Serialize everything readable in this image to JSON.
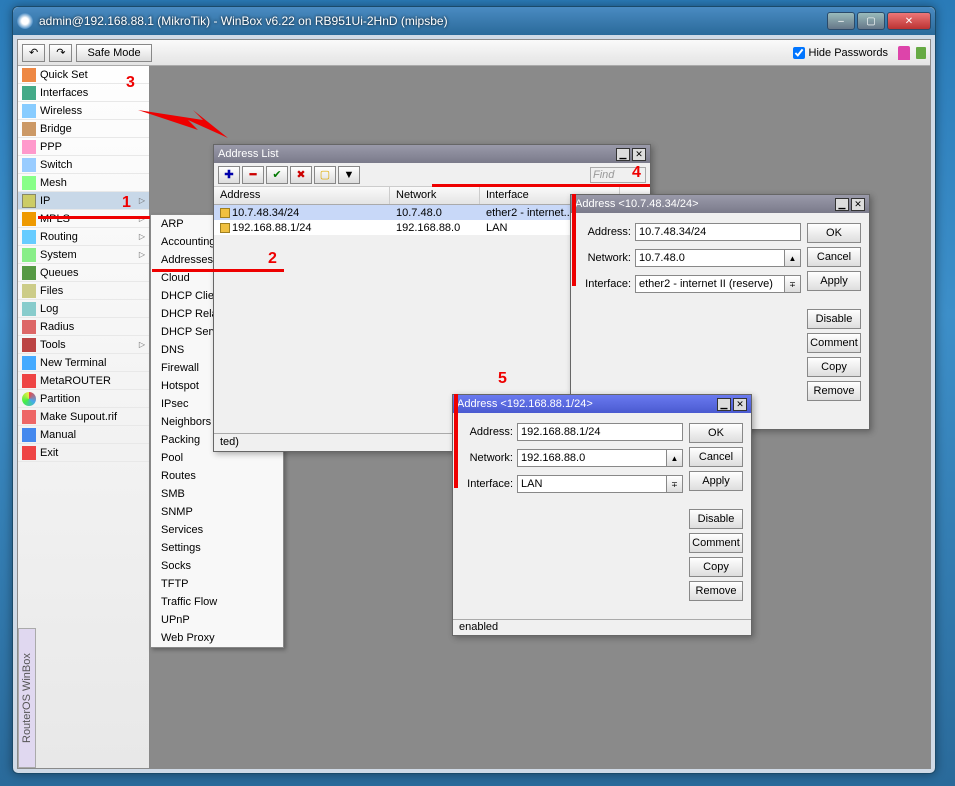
{
  "window": {
    "title": "admin@192.168.88.1 (MikroTik) - WinBox v6.22 on RB951Ui-2HnD (mipsbe)"
  },
  "toolbar": {
    "undo_glyph": "↶",
    "redo_glyph": "↷",
    "safe_mode": "Safe Mode",
    "hide_passwords": "Hide Passwords"
  },
  "sidebar": {
    "items": [
      {
        "label": "Quick Set",
        "icon": "i-quick"
      },
      {
        "label": "Interfaces",
        "icon": "i-if"
      },
      {
        "label": "Wireless",
        "icon": "i-wl"
      },
      {
        "label": "Bridge",
        "icon": "i-br"
      },
      {
        "label": "PPP",
        "icon": "i-ppp"
      },
      {
        "label": "Switch",
        "icon": "i-sw"
      },
      {
        "label": "Mesh",
        "icon": "i-mesh"
      },
      {
        "label": "IP",
        "icon": "i-ip",
        "sub": true,
        "sel": true
      },
      {
        "label": "MPLS",
        "icon": "i-mpls",
        "sub": true
      },
      {
        "label": "Routing",
        "icon": "i-rt",
        "sub": true
      },
      {
        "label": "System",
        "icon": "i-sys",
        "sub": true
      },
      {
        "label": "Queues",
        "icon": "i-q"
      },
      {
        "label": "Files",
        "icon": "i-fl"
      },
      {
        "label": "Log",
        "icon": "i-log"
      },
      {
        "label": "Radius",
        "icon": "i-rad"
      },
      {
        "label": "Tools",
        "icon": "i-tl",
        "sub": true
      },
      {
        "label": "New Terminal",
        "icon": "i-nt"
      },
      {
        "label": "MetaROUTER",
        "icon": "i-mr"
      },
      {
        "label": "Partition",
        "icon": "i-pt"
      },
      {
        "label": "Make Supout.rif",
        "icon": "i-ms"
      },
      {
        "label": "Manual",
        "icon": "i-mn"
      },
      {
        "label": "Exit",
        "icon": "i-ex"
      }
    ],
    "vertical_label": "RouterOS WinBox"
  },
  "submenu": {
    "items": [
      "ARP",
      "Accounting",
      "Addresses",
      "Cloud",
      "DHCP Client",
      "DHCP Relay",
      "DHCP Server",
      "DNS",
      "Firewall",
      "Hotspot",
      "IPsec",
      "Neighbors",
      "Packing",
      "Pool",
      "Routes",
      "SMB",
      "SNMP",
      "Services",
      "Settings",
      "Socks",
      "TFTP",
      "Traffic Flow",
      "UPnP",
      "Web Proxy"
    ]
  },
  "address_list": {
    "title": "Address List",
    "find_placeholder": "Find",
    "columns": [
      "Address",
      "Network",
      "Interface"
    ],
    "rows": [
      {
        "address": "10.7.48.34/24",
        "network": "10.7.48.0",
        "iface": "ether2 - internet..",
        "sel": true
      },
      {
        "address": "192.168.88.1/24",
        "network": "192.168.88.0",
        "iface": "LAN"
      }
    ],
    "status_suffix": "ted)",
    "toolbar_glyphs": {
      "add": "✚",
      "remove": "━",
      "enable": "✔",
      "disable": "✖",
      "comment": "▢",
      "filter": "▼"
    }
  },
  "dlg1": {
    "title": "Address <10.7.48.34/24>",
    "fields": {
      "address_lbl": "Address:",
      "address_val": "10.7.48.34/24",
      "network_lbl": "Network:",
      "network_val": "10.7.48.0",
      "iface_lbl": "Interface:",
      "iface_val": "ether2 - internet II (reserve)"
    },
    "buttons": [
      "OK",
      "Cancel",
      "Apply",
      "Disable",
      "Comment",
      "Copy",
      "Remove"
    ]
  },
  "dlg2": {
    "title": "Address <192.168.88.1/24>",
    "fields": {
      "address_lbl": "Address:",
      "address_val": "192.168.88.1/24",
      "network_lbl": "Network:",
      "network_val": "192.168.88.0",
      "iface_lbl": "Interface:",
      "iface_val": "LAN"
    },
    "buttons": [
      "OK",
      "Cancel",
      "Apply",
      "Disable",
      "Comment",
      "Copy",
      "Remove"
    ],
    "status": "enabled"
  },
  "annotations": {
    "n1": "1",
    "n2": "2",
    "n3": "3",
    "n4": "4",
    "n5": "5"
  }
}
